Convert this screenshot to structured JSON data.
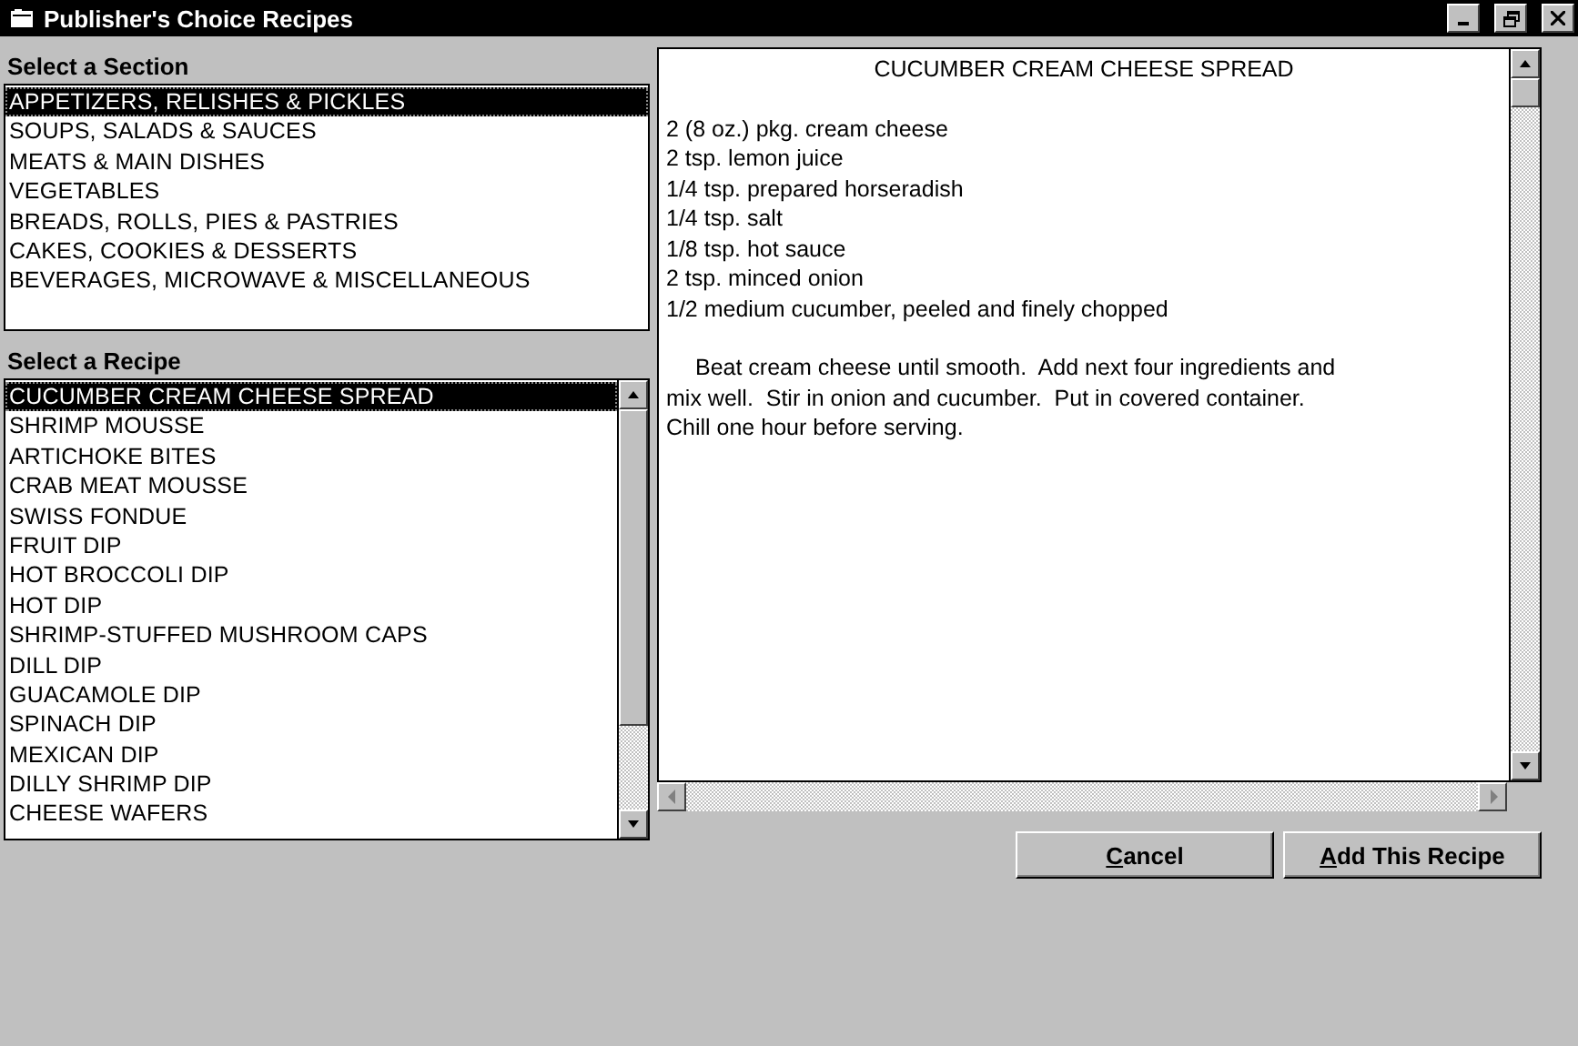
{
  "window": {
    "title": "Publisher's Choice Recipes"
  },
  "sections": {
    "heading": "Select a Section",
    "items": [
      {
        "label": "APPETIZERS, RELISHES & PICKLES",
        "selected": true
      },
      {
        "label": "SOUPS, SALADS & SAUCES",
        "selected": false
      },
      {
        "label": "MEATS & MAIN DISHES",
        "selected": false
      },
      {
        "label": "VEGETABLES",
        "selected": false
      },
      {
        "label": "BREADS, ROLLS, PIES & PASTRIES",
        "selected": false
      },
      {
        "label": "CAKES, COOKIES & DESSERTS",
        "selected": false
      },
      {
        "label": "BEVERAGES, MICROWAVE & MISCELLANEOUS",
        "selected": false
      }
    ]
  },
  "recipes": {
    "heading": "Select a Recipe",
    "items": [
      {
        "label": "CUCUMBER CREAM CHEESE SPREAD",
        "selected": true
      },
      {
        "label": "SHRIMP MOUSSE",
        "selected": false
      },
      {
        "label": "ARTICHOKE BITES",
        "selected": false
      },
      {
        "label": "CRAB MEAT MOUSSE",
        "selected": false
      },
      {
        "label": "SWISS FONDUE",
        "selected": false
      },
      {
        "label": "FRUIT DIP",
        "selected": false
      },
      {
        "label": "HOT BROCCOLI DIP",
        "selected": false
      },
      {
        "label": "HOT DIP",
        "selected": false
      },
      {
        "label": "SHRIMP-STUFFED MUSHROOM CAPS",
        "selected": false
      },
      {
        "label": "DILL DIP",
        "selected": false
      },
      {
        "label": "GUACAMOLE DIP",
        "selected": false
      },
      {
        "label": "SPINACH DIP",
        "selected": false
      },
      {
        "label": "MEXICAN DIP",
        "selected": false
      },
      {
        "label": "DILLY SHRIMP DIP",
        "selected": false
      },
      {
        "label": "CHEESE WAFERS",
        "selected": false
      }
    ]
  },
  "recipe_text": {
    "title": "CUCUMBER CREAM CHEESE SPREAD",
    "ingredients": [
      "2 (8 oz.) pkg. cream cheese",
      "2 tsp. lemon juice",
      "1/4 tsp. prepared horseradish",
      "1/4 tsp. salt",
      "1/8 tsp. hot sauce",
      "2 tsp. minced onion",
      "1/2 medium cucumber, peeled and finely chopped"
    ],
    "directions": [
      "Beat cream cheese until smooth.  Add next four ingredients and",
      "mix well.  Stir in onion and cucumber.  Put in covered container.",
      "Chill one hour before serving."
    ]
  },
  "buttons": [
    {
      "mnemonic": "C",
      "rest": "ancel"
    },
    {
      "mnemonic": "A",
      "rest": "dd This Recipe"
    }
  ]
}
